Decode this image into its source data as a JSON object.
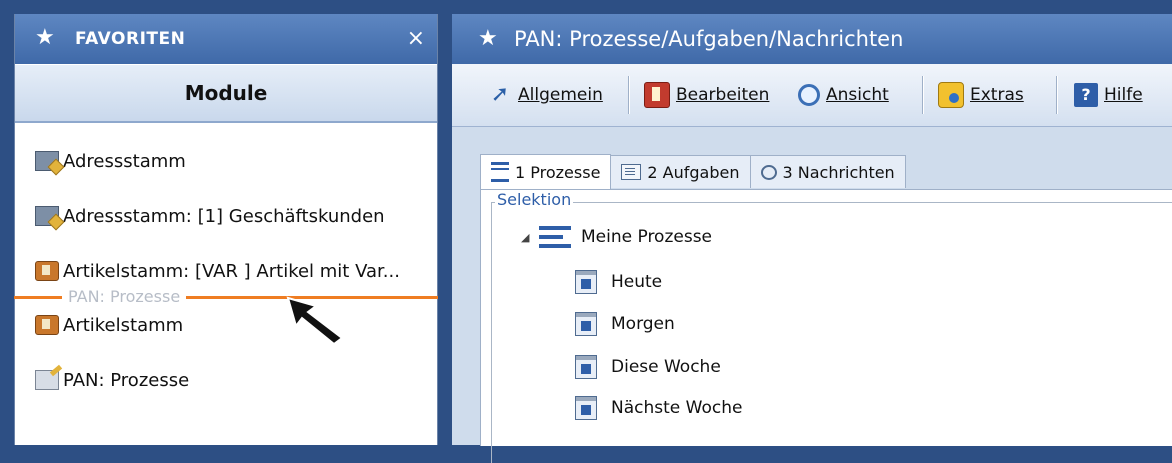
{
  "left_panel": {
    "title": "FAVORITEN",
    "close_glyph": "×",
    "module_header": "Module",
    "items": [
      {
        "label": "Adressstamm",
        "icon": "address-book-icon"
      },
      {
        "label": "Adressstamm: [1] Geschäftskunden",
        "icon": "address-book-icon"
      },
      {
        "label": "Artikelstamm: [VAR  ] Artikel mit Var...",
        "icon": "article-icon"
      },
      {
        "label": "Artikelstamm",
        "icon": "article-icon"
      },
      {
        "label": "PAN: Prozesse",
        "icon": "process-icon"
      }
    ],
    "drag_label": "PAN: Prozesse",
    "drop_indicator_color": "#ef7d22"
  },
  "right_panel": {
    "title": "PAN: Prozesse/Aufgaben/Nachrichten",
    "toolbar": {
      "allgemein": "Allgemein",
      "bearbeiten": "Bearbeiten",
      "ansicht": "Ansicht",
      "extras": "Extras",
      "hilfe": "Hilfe"
    },
    "tabs": [
      {
        "label": "1 Prozesse",
        "active": true
      },
      {
        "label": "2 Aufgaben",
        "active": false
      },
      {
        "label": "3 Nachrichten",
        "active": false
      }
    ],
    "selektion_label": "Selektion",
    "tree": {
      "root": "Meine Prozesse",
      "children": [
        "Heute",
        "Morgen",
        "Diese Woche",
        "Nächste Woche"
      ]
    }
  },
  "colors": {
    "header_blue": "#4f79b8",
    "accent_orange": "#ef7d22"
  }
}
